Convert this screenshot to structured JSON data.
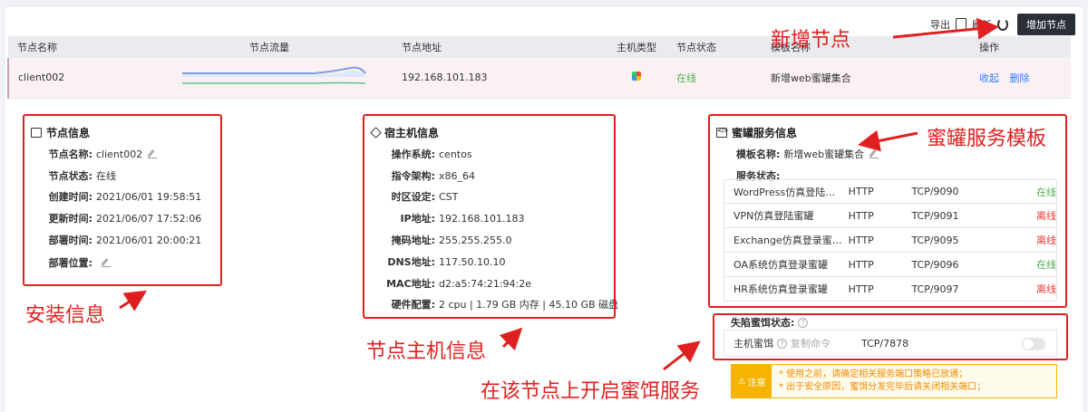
{
  "toolbar": {
    "export": "导出",
    "refresh": "刷新",
    "add_node": "增加节点"
  },
  "table": {
    "headers": [
      "节点名称",
      "节点流量",
      "节点地址",
      "主机类型",
      "节点状态",
      "模板名称",
      "操作"
    ],
    "row": {
      "name": "client002",
      "address": "192.168.101.183",
      "status": "在线",
      "template": "新增web蜜罐集合",
      "action_collapse": "收起",
      "action_delete": "删除"
    }
  },
  "node_info": {
    "title": "节点信息",
    "fields": [
      {
        "k": "节点名称:",
        "v": "client002"
      },
      {
        "k": "节点状态:",
        "v": "在线"
      },
      {
        "k": "创建时间:",
        "v": "2021/06/01 19:58:51"
      },
      {
        "k": "更新时间:",
        "v": "2021/06/07 17:52:06"
      },
      {
        "k": "部署时间:",
        "v": "2021/06/01 20:00:21"
      },
      {
        "k": "部署位置:",
        "v": ""
      }
    ]
  },
  "host_info": {
    "title": "宿主机信息",
    "fields": [
      {
        "k": "操作系统:",
        "v": "centos"
      },
      {
        "k": "指令架构:",
        "v": "x86_64"
      },
      {
        "k": "时区设定:",
        "v": "CST"
      },
      {
        "k": "IP地址:",
        "v": "192.168.101.183"
      },
      {
        "k": "掩码地址:",
        "v": "255.255.255.0"
      },
      {
        "k": "DNS地址:",
        "v": "117.50.10.10"
      },
      {
        "k": "MAC地址:",
        "v": "d2:a5:74:21:94:2e"
      },
      {
        "k": "硬件配置:",
        "v": "2 cpu | 1.79 GB 内存 | 45.10 GB 磁盘"
      }
    ]
  },
  "honeypot_info": {
    "title": "蜜罐服务信息",
    "template_label": "模板名称:",
    "template_value": "新增web蜜罐集合",
    "service_status_label": "服务状态:",
    "services": [
      {
        "name": "WordPress仿真登陆…",
        "proto": "HTTP",
        "port": "TCP/9090",
        "status": "在线",
        "ok": true
      },
      {
        "name": "VPN仿真登陆蜜罐",
        "proto": "HTTP",
        "port": "TCP/9091",
        "status": "离线",
        "ok": false
      },
      {
        "name": "Exchange仿真登录蜜…",
        "proto": "HTTP",
        "port": "TCP/9095",
        "status": "离线",
        "ok": false
      },
      {
        "name": "OA系统仿真登录蜜罐",
        "proto": "HTTP",
        "port": "TCP/9096",
        "status": "在线",
        "ok": true
      },
      {
        "name": "HR系统仿真登录蜜罐",
        "proto": "HTTP",
        "port": "TCP/9097",
        "status": "离线",
        "ok": false
      }
    ]
  },
  "bait": {
    "label": "失陷蜜饵状态:",
    "item_name": "主机蜜饵",
    "copy_cmd": "复制命令",
    "port": "TCP/7878"
  },
  "notice": {
    "tag": "注意",
    "line1": "* 使用之前，请确定相关服务端口策略已放通；",
    "line2": "* 出于安全原因，蜜饵分发完毕后请关闭相关端口；"
  },
  "annotations": {
    "add_node": "新增节点",
    "honeypot_template": "蜜罐服务模板",
    "install_info": "安装信息",
    "host_info": "节点主机信息",
    "enable_bait": "在该节点上开启蜜饵服务"
  },
  "colors": {
    "online": "#4caf50",
    "offline": "#e53935",
    "annotation": "#e02020",
    "link": "#2f7df6"
  }
}
